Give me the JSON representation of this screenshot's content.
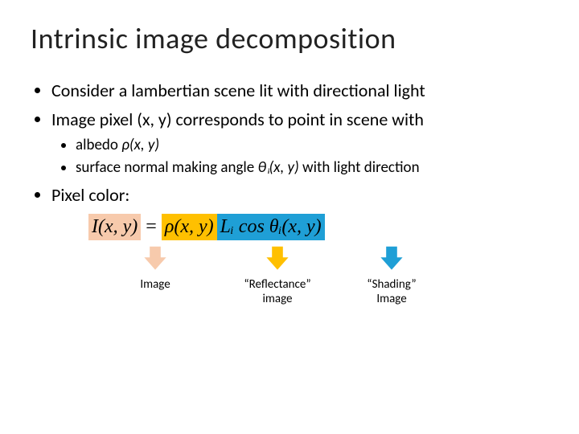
{
  "title": "Intrinsic image decomposition",
  "bullets": {
    "b1": "Consider a lambertian scene lit with directional light",
    "b2": "Image pixel (x, y) corresponds to point in scene with",
    "b2a_prefix": "albedo ",
    "b2a_math": "ρ(x, y)",
    "b2b_prefix": "surface normal making angle ",
    "b2b_math": "θᵢ(x, y)",
    "b2b_suffix": " with light direction",
    "b3": "Pixel color:"
  },
  "formula": {
    "lhs": "I(x, y)",
    "eq": "=",
    "mid": "ρ(x, y)",
    "rhs": "Lᵢ cos θᵢ(x, y)"
  },
  "labels": {
    "image": "Image",
    "reflectance_l1": "“Reflectance”",
    "reflectance_l2": "image",
    "shading_l1": "“Shading”",
    "shading_l2": "Image"
  },
  "colors": {
    "peach": "#f7caac",
    "gold": "#ffc000",
    "blue": "#1f9fd6"
  }
}
